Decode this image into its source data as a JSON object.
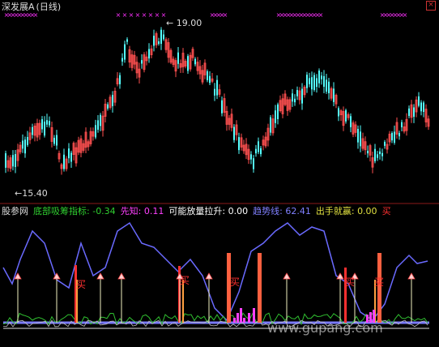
{
  "header": {
    "symbol": "深发展A",
    "period": "(日线)",
    "high_label": "19.00",
    "low_label": "15.40"
  },
  "indicator": {
    "site": "股参网",
    "name": "底部吸筹指标:",
    "name_value": "-0.34",
    "xianzhi_label": "先知:",
    "xianzhi_value": "0.11",
    "fangliang_label": "可能放量拉升:",
    "fangliang_value": "0.00",
    "trend_label": "趋势线:",
    "trend_value": "62.41",
    "chushou_label": "出手就赢:",
    "chushou_value": "0.00",
    "buy_label": "买"
  },
  "signals": {
    "buy_texts": [
      "买",
      "买",
      "买",
      "买"
    ]
  },
  "watermark": "www.gupang.com",
  "colors": {
    "up": "#ff5050",
    "down": "#54ffff",
    "trend": "#6a6aff",
    "marker": "#ff30ff",
    "bar": "#ff6040",
    "buy_text": "#ff3030",
    "label_green": "#30d030",
    "label_magenta": "#ff40ff",
    "label_yellow": "#e0e040"
  }
}
